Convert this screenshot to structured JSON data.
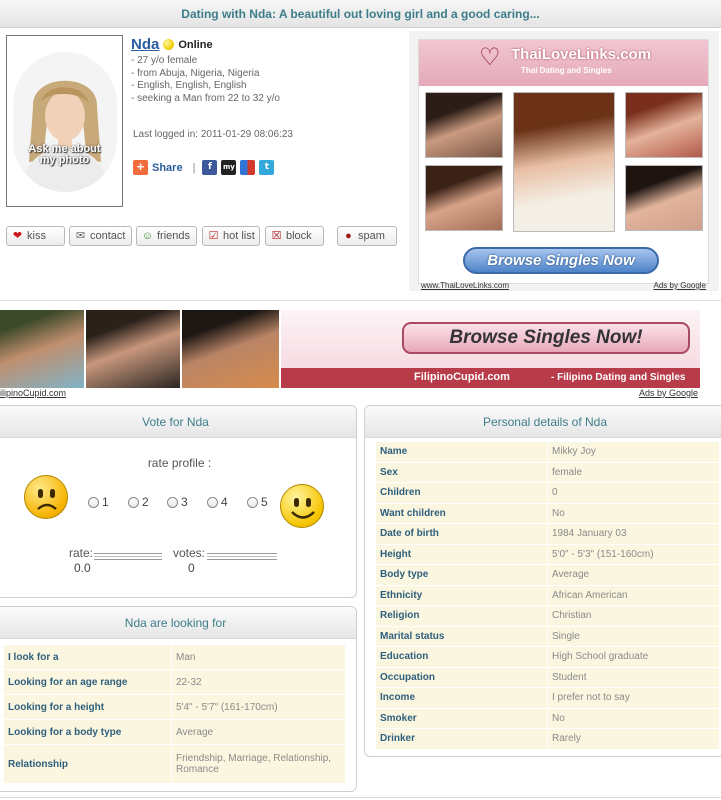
{
  "page": {
    "title": "Dating with Nda: A beautiful out loving girl and a good caring..."
  },
  "profile": {
    "name": "Nda",
    "status": "Online",
    "details": [
      "- 27 y/o female",
      "- from Abuja, Nigeria, Nigeria",
      "- English, English, English",
      "- seeking a Man from 22 to 32 y/o"
    ],
    "last_logged": "Last logged in: 2011-01-29 08:06:23",
    "photo_placeholder_line1": "Ask me about",
    "photo_placeholder_line2": "my photo"
  },
  "share": {
    "label": "Share",
    "separator": "|",
    "icons": [
      "facebook-icon",
      "myspace-icon",
      "delicious-icon",
      "twitter-icon"
    ],
    "glyphs": {
      "facebook": "f",
      "myspace": "my",
      "twitter": "t"
    }
  },
  "actions": [
    {
      "label": "kiss",
      "icon": "heart-icon",
      "glyph": "❤"
    },
    {
      "label": "contact",
      "icon": "note-icon",
      "glyph": "✉"
    },
    {
      "label": "friends",
      "icon": "friends-icon",
      "glyph": "☺"
    },
    {
      "label": "hot list",
      "icon": "checkbox-icon",
      "glyph": "☑"
    },
    {
      "label": "block",
      "icon": "block-icon",
      "glyph": "☒"
    },
    {
      "label": "spam",
      "icon": "bomb-icon",
      "glyph": "●"
    }
  ],
  "ad_right": {
    "brand": "ThaiLoveLinks.com",
    "tagline": "Thai Dating and Singles",
    "button": "Browse Singles Now",
    "url": "www.ThaiLoveLinks.com",
    "ads_by": "Ads by Google"
  },
  "ad_banner": {
    "button": "Browse Singles Now!",
    "brand": "FilipinoCupid.com",
    "tagline": "- Filipino Dating and Singles",
    "url": "ilipinoCupid.com",
    "ads_by": "Ads by Google"
  },
  "vote": {
    "header": "Vote for Nda",
    "rate_title": "rate profile :",
    "options": [
      "1",
      "2",
      "3",
      "4",
      "5"
    ],
    "rate_label": "rate:",
    "rate_value": "0.0",
    "votes_label": "votes:",
    "votes_value": "0"
  },
  "looking": {
    "header": "Nda are looking for",
    "rows": [
      {
        "key": "I look for a",
        "value": "Man"
      },
      {
        "key": "Looking for an age range",
        "value": "22-32"
      },
      {
        "key": "Looking for a height",
        "value": "5'4\" - 5'7\" (161-170cm)"
      },
      {
        "key": "Looking for a body type",
        "value": "Average"
      },
      {
        "key": "Relationship",
        "value": "Friendship, Marriage, Relationship, Romance"
      }
    ]
  },
  "personal": {
    "header": "Personal details of Nda",
    "rows": [
      {
        "key": "Name",
        "value": "Mikky Joy"
      },
      {
        "key": "Sex",
        "value": "female"
      },
      {
        "key": "Children",
        "value": "0"
      },
      {
        "key": "Want children",
        "value": "No"
      },
      {
        "key": "Date of birth",
        "value": "1984 January 03"
      },
      {
        "key": "Height",
        "value": "5'0\" - 5'3\" (151-160cm)"
      },
      {
        "key": "Body type",
        "value": "Average"
      },
      {
        "key": "Ethnicity",
        "value": "African American"
      },
      {
        "key": "Religion",
        "value": "Christian"
      },
      {
        "key": "Marital status",
        "value": "Single"
      },
      {
        "key": "Education",
        "value": "High School graduate"
      },
      {
        "key": "Occupation",
        "value": "Student"
      },
      {
        "key": "Income",
        "value": "I prefer not to say"
      },
      {
        "key": "Smoker",
        "value": "No"
      },
      {
        "key": "Drinker",
        "value": "Rarely"
      }
    ]
  },
  "colors": {
    "header_text": "#3d7d8a",
    "link": "#2b5e9e",
    "table_key": "#2e5f7d",
    "table_bg": "#fbf6df"
  }
}
